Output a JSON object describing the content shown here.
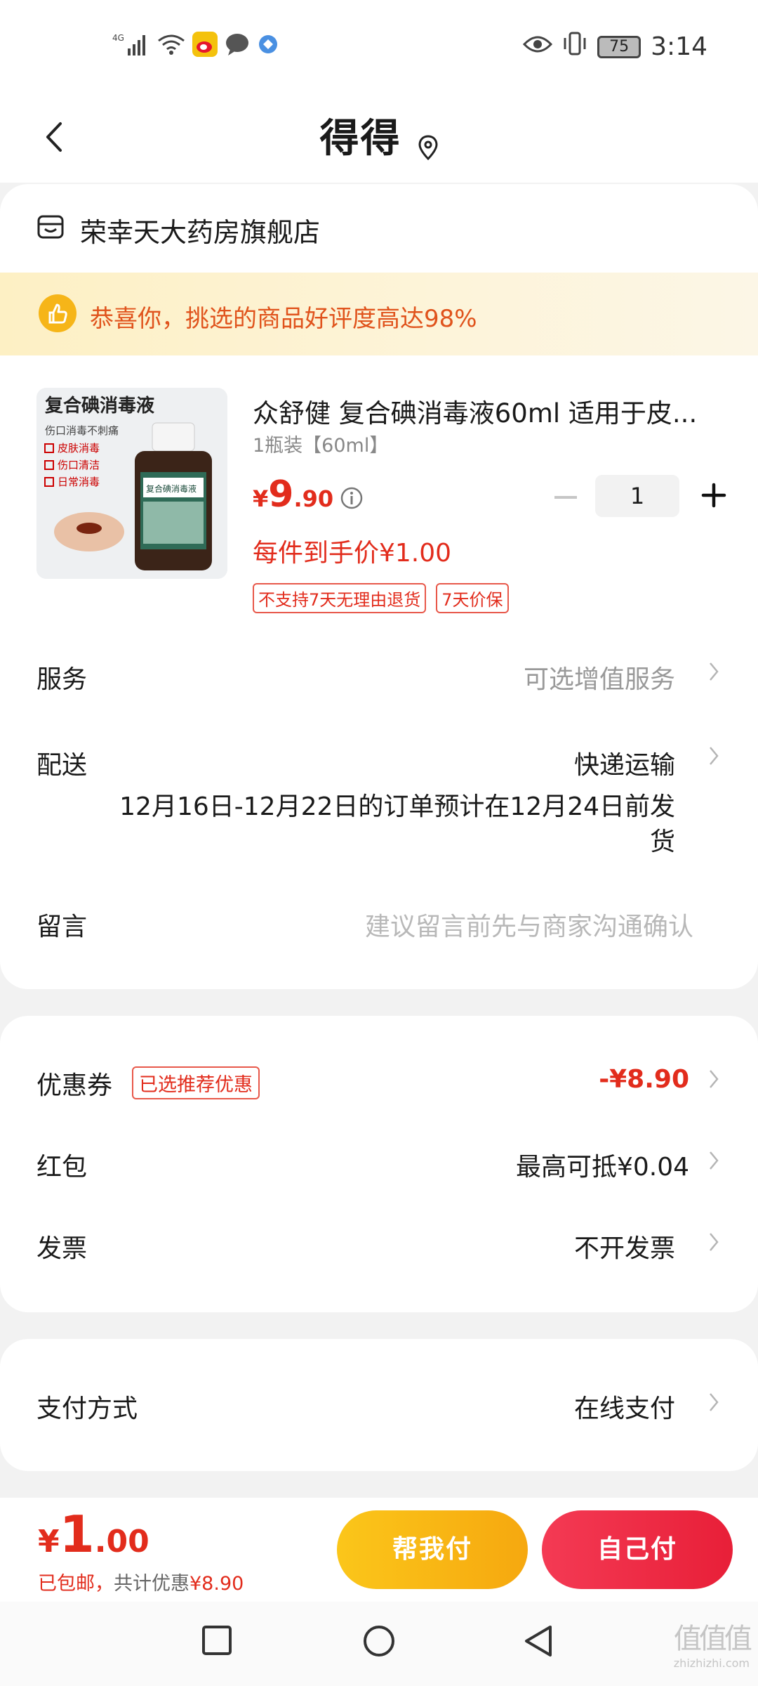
{
  "status_bar": {
    "time": "3:14",
    "battery": "75",
    "network": "4G"
  },
  "header": {
    "title": "得得"
  },
  "shop": {
    "name": "荣幸天大药房旗舰店"
  },
  "banner": {
    "text": "恭喜你，挑选的商品好评度高达98%"
  },
  "product": {
    "image_title": "复合碘消毒液",
    "image_subtitle": "伤口消毒不刺痛",
    "image_features": [
      "皮肤消毒",
      "伤口清洁",
      "日常消毒"
    ],
    "image_bottle_label": "复合碘消毒液",
    "title": "众舒健 复合碘消毒液60ml 适用于皮...",
    "spec": "1瓶装【60ml】",
    "price_currency": "¥",
    "price_int": "9",
    "price_dec": ".90",
    "quantity": "1",
    "per_item_price": "每件到手价¥1.00",
    "tags": [
      "不支持7天无理由退货",
      "7天价保"
    ]
  },
  "service": {
    "label": "服务",
    "value": "可选增值服务"
  },
  "delivery": {
    "label": "配送",
    "value": "快递运输",
    "note": "12月16日-12月22日的订单预计在12月24日前发货"
  },
  "message": {
    "label": "留言",
    "placeholder": "建议留言前先与商家沟通确认"
  },
  "coupon": {
    "label": "优惠券",
    "tag": "已选推荐优惠",
    "value": "-¥8.90"
  },
  "red_packet": {
    "label": "红包",
    "value": "最高可抵¥0.04"
  },
  "invoice": {
    "label": "发票",
    "value": "不开发票"
  },
  "payment": {
    "label": "支付方式",
    "value": "在线支付"
  },
  "bottom": {
    "total_currency": "¥",
    "total_int": "1",
    "total_dec": ".00",
    "ship_note_red": "已包邮，",
    "ship_note_gray": "共计优惠",
    "ship_note_discount": "¥8.90",
    "help_pay": "帮我付",
    "self_pay": "自己付"
  },
  "watermark": {
    "big": "值值值",
    "small": "zhizhizhi.com"
  },
  "colors": {
    "price_red": "#e22c1c",
    "banner_bg": "#fdf0c4",
    "help_btn": "#f6a80f",
    "self_btn": "#e81f38"
  }
}
